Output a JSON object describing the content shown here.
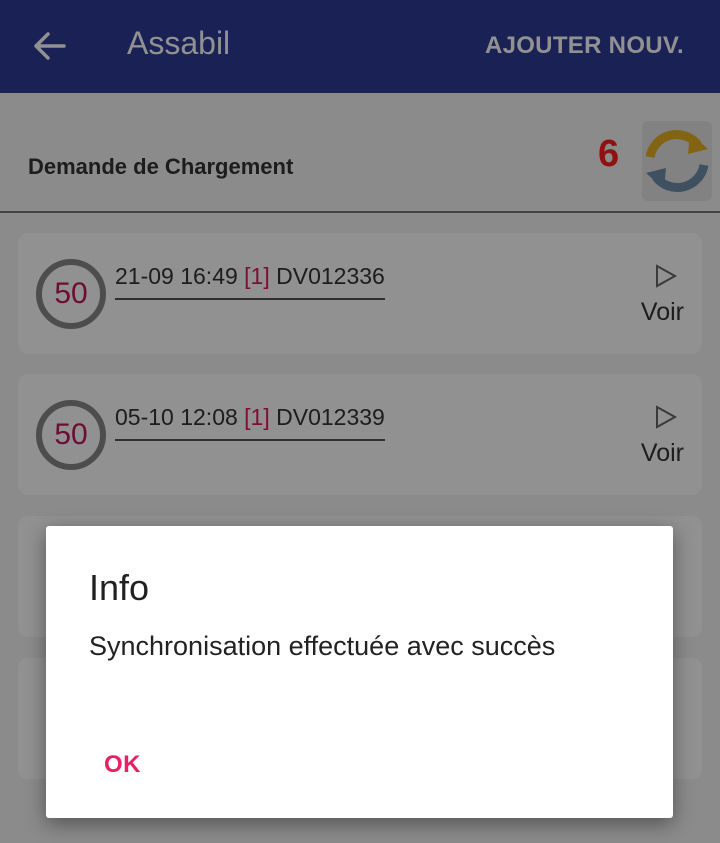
{
  "app_bar": {
    "title": "Assabil",
    "action_label": "AJOUTER NOUV.",
    "back_icon": "arrow-left-icon"
  },
  "section": {
    "title": "Demande de Chargement",
    "count": "6",
    "refresh_icon": "sync-icon"
  },
  "requests": [
    {
      "badge": "50",
      "date": "21-09 16:49",
      "qty": "[1]",
      "ref": "DV012336",
      "action": "Voir"
    },
    {
      "badge": "50",
      "date": "05-10 12:08",
      "qty": "[1]",
      "ref": "DV012339",
      "action": "Voir"
    }
  ],
  "dialog": {
    "title": "Info",
    "message": "Synchronisation effectuée avec succès",
    "ok_label": "OK"
  },
  "colors": {
    "primary": "#2e3b94",
    "accent": "#e91e63",
    "count": "#ff1f1f"
  }
}
